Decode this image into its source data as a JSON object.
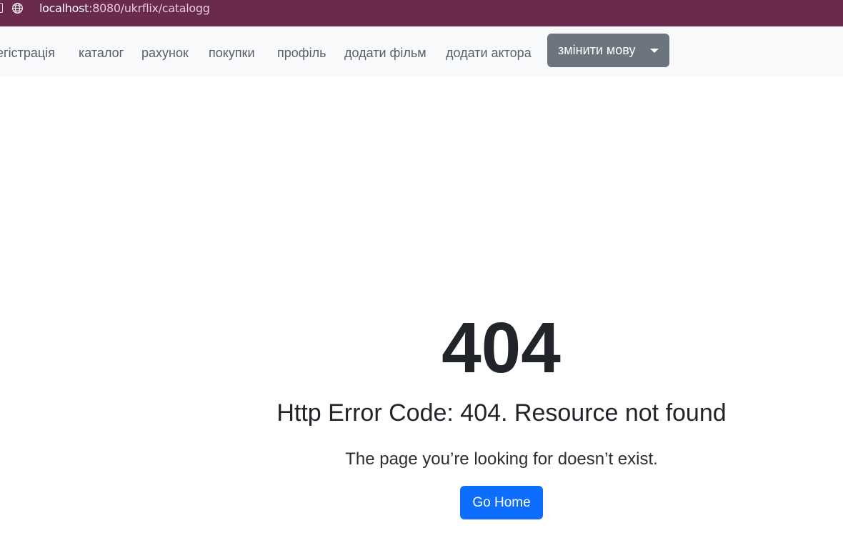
{
  "browser": {
    "url_host": "localhost",
    "url_rest": ":8080/ukrflix/catalogg"
  },
  "navbar": {
    "links": [
      "егістрація",
      "каталог",
      "рахунок",
      "покупки",
      "профіль",
      "додати фільм",
      "додати актора"
    ],
    "language_button": "змінити мову"
  },
  "error": {
    "code": "404",
    "title": "Http Error Code: 404. Resource not found",
    "message": "The page you’re looking for doesn’t exist.",
    "home_button": "Go Home"
  },
  "colors": {
    "address_bar": "#6a2a4e",
    "navbar_bg": "#f8f9fa",
    "language_button_bg": "#6c757d",
    "primary_button_bg": "#0d6efd"
  },
  "icons": {
    "address_bar": "globe-icon",
    "language_dropdown": "caret-down-icon"
  }
}
